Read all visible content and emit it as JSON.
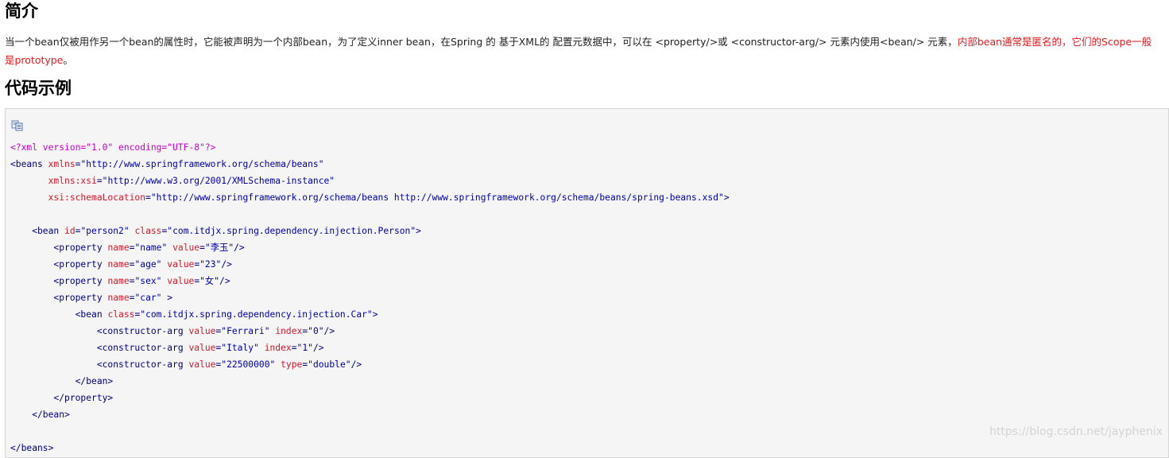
{
  "headings": {
    "intro": "简介",
    "code": "代码示例"
  },
  "intro": {
    "text_main": "当一个bean仅被用作另一个bean的属性时，它能被声明为一个内部bean，为了定义inner bean，在Spring 的 基于XML的 配置元数据中，可以在 <property/>或 <constructor-arg/> 元素内使用<bean/> 元素，",
    "text_red": "内部bean通常是匿名的，它们的Scope一般是prototype",
    "text_end": "。"
  },
  "code_block": {
    "copy_icon": "copy-icon",
    "lines": [
      [
        [
          "pi",
          "<?xml version=\"1.0\" encoding=\"UTF-8\"?>"
        ]
      ],
      [
        [
          "tg",
          "<beans "
        ],
        [
          "at",
          "xmlns"
        ],
        [
          "tg",
          "="
        ],
        [
          "vl",
          "\"http://www.springframework.org/schema/beans\""
        ]
      ],
      [
        [
          "tg",
          "       "
        ],
        [
          "at",
          "xmlns:xsi"
        ],
        [
          "tg",
          "="
        ],
        [
          "vl",
          "\"http://www.w3.org/2001/XMLSchema-instance\""
        ]
      ],
      [
        [
          "tg",
          "       "
        ],
        [
          "at",
          "xsi:schemaLocation"
        ],
        [
          "tg",
          "="
        ],
        [
          "vl",
          "\"http://www.springframework.org/schema/beans http://www.springframework.org/schema/beans/spring-beans.xsd\""
        ],
        [
          "tg",
          ">"
        ]
      ],
      [
        [
          "tg",
          " "
        ]
      ],
      [
        [
          "tg",
          "    <bean "
        ],
        [
          "at",
          "id"
        ],
        [
          "tg",
          "="
        ],
        [
          "vl",
          "\"person2\""
        ],
        [
          "tg",
          " "
        ],
        [
          "at",
          "class"
        ],
        [
          "tg",
          "="
        ],
        [
          "vl",
          "\"com.itdjx.spring.dependency.injection.Person\""
        ],
        [
          "tg",
          ">"
        ]
      ],
      [
        [
          "tg",
          "        <property "
        ],
        [
          "at",
          "name"
        ],
        [
          "tg",
          "="
        ],
        [
          "vl",
          "\"name\""
        ],
        [
          "tg",
          " "
        ],
        [
          "at",
          "value"
        ],
        [
          "tg",
          "="
        ],
        [
          "vl",
          "\"李玉\""
        ],
        [
          "tg",
          "/>"
        ]
      ],
      [
        [
          "tg",
          "        <property "
        ],
        [
          "at",
          "name"
        ],
        [
          "tg",
          "="
        ],
        [
          "vl",
          "\"age\""
        ],
        [
          "tg",
          " "
        ],
        [
          "at",
          "value"
        ],
        [
          "tg",
          "="
        ],
        [
          "vl",
          "\"23\""
        ],
        [
          "tg",
          "/>"
        ]
      ],
      [
        [
          "tg",
          "        <property "
        ],
        [
          "at",
          "name"
        ],
        [
          "tg",
          "="
        ],
        [
          "vl",
          "\"sex\""
        ],
        [
          "tg",
          " "
        ],
        [
          "at",
          "value"
        ],
        [
          "tg",
          "="
        ],
        [
          "vl",
          "\"女\""
        ],
        [
          "tg",
          "/>"
        ]
      ],
      [
        [
          "tg",
          "        <property "
        ],
        [
          "at",
          "name"
        ],
        [
          "tg",
          "="
        ],
        [
          "vl",
          "\"car\""
        ],
        [
          "tg",
          " >"
        ]
      ],
      [
        [
          "tg",
          "            <bean "
        ],
        [
          "at",
          "class"
        ],
        [
          "tg",
          "="
        ],
        [
          "vl",
          "\"com.itdjx.spring.dependency.injection.Car\""
        ],
        [
          "tg",
          ">"
        ]
      ],
      [
        [
          "tg",
          "                <constructor-arg "
        ],
        [
          "at",
          "value"
        ],
        [
          "tg",
          "="
        ],
        [
          "vl",
          "\"Ferrari\""
        ],
        [
          "tg",
          " "
        ],
        [
          "at",
          "index"
        ],
        [
          "tg",
          "="
        ],
        [
          "vl",
          "\"0\""
        ],
        [
          "tg",
          "/>"
        ]
      ],
      [
        [
          "tg",
          "                <constructor-arg "
        ],
        [
          "at",
          "value"
        ],
        [
          "tg",
          "="
        ],
        [
          "vl",
          "\"Italy\""
        ],
        [
          "tg",
          " "
        ],
        [
          "at",
          "index"
        ],
        [
          "tg",
          "="
        ],
        [
          "vl",
          "\"1\""
        ],
        [
          "tg",
          "/>"
        ]
      ],
      [
        [
          "tg",
          "                <constructor-arg "
        ],
        [
          "at",
          "value"
        ],
        [
          "tg",
          "="
        ],
        [
          "vl",
          "\"22500000\""
        ],
        [
          "tg",
          " "
        ],
        [
          "at",
          "type"
        ],
        [
          "tg",
          "="
        ],
        [
          "vl",
          "\"double\""
        ],
        [
          "tg",
          "/>"
        ]
      ],
      [
        [
          "tg",
          "            </bean>"
        ]
      ],
      [
        [
          "tg",
          "        </property>"
        ]
      ],
      [
        [
          "tg",
          "    </bean>"
        ]
      ],
      [
        [
          "tg",
          " "
        ]
      ],
      [
        [
          "tg",
          "</beans>"
        ]
      ]
    ]
  },
  "watermark": "https://blog.csdn.net/jayphenix"
}
